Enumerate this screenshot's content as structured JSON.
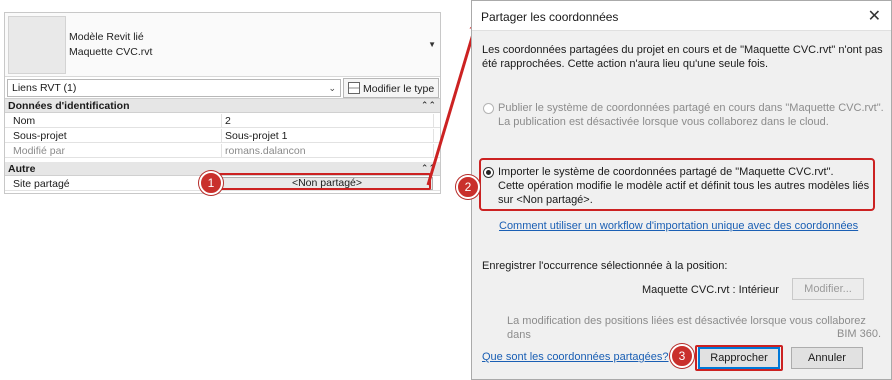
{
  "properties": {
    "type_line1": "Modèle Revit lié",
    "type_line2": "Maquette CVC.rvt",
    "selector": "Liens RVT (1)",
    "edit_type_label": "Modifier le type",
    "groups": {
      "identity": "Données d'identification",
      "other": "Autre"
    },
    "rows": [
      {
        "name": "Nom",
        "value": "2"
      },
      {
        "name": "Sous-projet",
        "value": "Sous-projet 1"
      },
      {
        "name": "Modifié par",
        "value": "romans.dalancon"
      }
    ],
    "shared_site": {
      "name": "Site partagé",
      "value": "<Non partagé>"
    }
  },
  "dialog": {
    "title": "Partager les coordonnées",
    "intro_line1": "Les coordonnées partagées du projet en cours et de \"Maquette CVC.rvt\" n'ont pas",
    "intro_line2": "été rapprochées. Cette action n'aura lieu qu'une seule fois.",
    "publish_option": {
      "line1": "Publier le système de coordonnées partagé en cours dans \"Maquette CVC.rvt\".",
      "line2": "La publication est désactivée lorsque vous collaborez dans le cloud."
    },
    "import_option": {
      "line1": "Importer le système de coordonnées partagé de \"Maquette CVC.rvt\".",
      "line2": "Cette opération modifie le modèle actif et définit tous les autres modèles liés",
      "line3": "sur <Non partagé>."
    },
    "workflow_link": "Comment utiliser un workflow d'importation unique avec des coordonnées",
    "record_label": "Enregistrer l'occurrence sélectionnée à la position:",
    "position_value": "Maquette CVC.rvt : Intérieur",
    "modify_button": "Modifier...",
    "disabled_note_line1": "La modification des positions liées est désactivée lorsque vous collaborez dans",
    "disabled_note_line2": "BIM 360.",
    "help_link": "Que sont les coordonnées partagées?",
    "reconcile_button": "Rapprocher",
    "cancel_button": "Annuler"
  },
  "annotations": {
    "badge_1": "1",
    "badge_2": "2",
    "badge_3": "3",
    "color": "#cc2222"
  }
}
